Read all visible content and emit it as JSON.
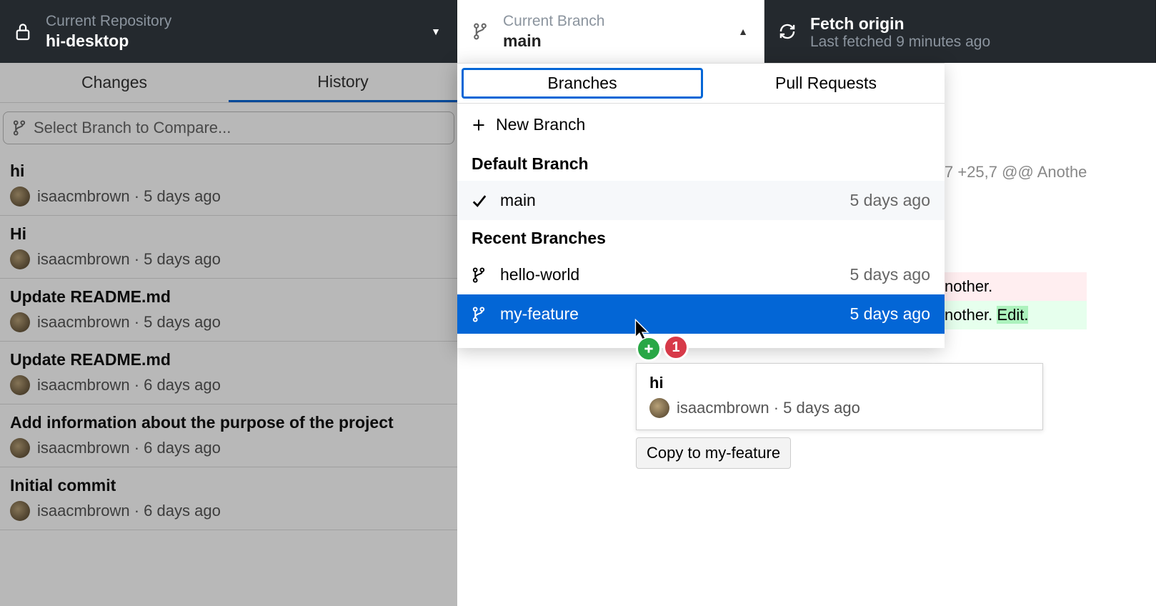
{
  "topbar": {
    "repo_label": "Current Repository",
    "repo_name": "hi-desktop",
    "branch_label": "Current Branch",
    "branch_name": "main",
    "fetch_title": "Fetch origin",
    "fetch_sub": "Last fetched 9 minutes ago"
  },
  "side_tabs": {
    "changes": "Changes",
    "history": "History"
  },
  "compare_placeholder": "Select Branch to Compare...",
  "commits": [
    {
      "title": "hi",
      "author": "isaacmbrown",
      "time": "5 days ago"
    },
    {
      "title": "Hi",
      "author": "isaacmbrown",
      "time": "5 days ago"
    },
    {
      "title": "Update README.md",
      "author": "isaacmbrown",
      "time": "5 days ago"
    },
    {
      "title": "Update README.md",
      "author": "isaacmbrown",
      "time": "6 days ago"
    },
    {
      "title": "Add information about the purpose of the project",
      "author": "isaacmbrown",
      "time": "6 days ago"
    },
    {
      "title": "Initial commit",
      "author": "isaacmbrown",
      "time": "6 days ago"
    }
  ],
  "dd_tabs": {
    "branches": "Branches",
    "prs": "Pull Requests"
  },
  "new_branch": "New Branch",
  "section_default": "Default Branch",
  "section_recent": "Recent Branches",
  "branches": {
    "default": {
      "name": "main",
      "time": "5 days ago"
    },
    "recent": [
      {
        "name": "hello-world",
        "time": "5 days ago"
      },
      {
        "name": "my-feature",
        "time": "5 days ago"
      }
    ]
  },
  "drag": {
    "badge_count": "1",
    "title": "hi",
    "author": "isaacmbrown",
    "time": "5 days ago",
    "tip": "Copy to my-feature"
  },
  "diff": {
    "hunk": "7 +25,7 @@ Anothe",
    "del_text": "nother.",
    "add_text": "nother.",
    "add_hl": "Edit."
  }
}
